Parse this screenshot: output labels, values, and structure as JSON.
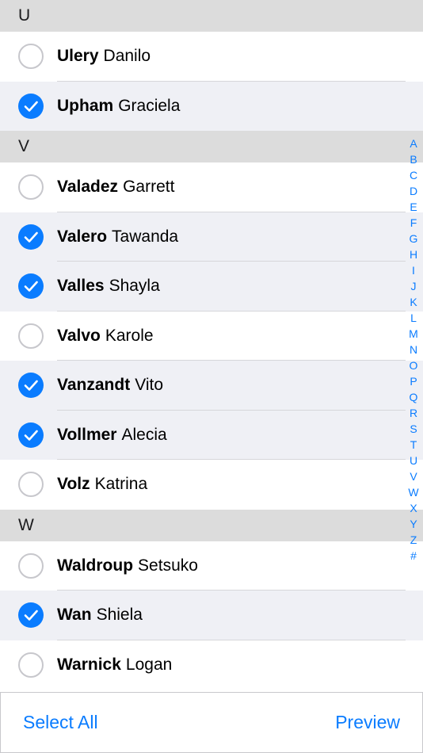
{
  "sections": [
    {
      "header": "U",
      "rows": [
        {
          "last": "Ulery",
          "first": "Danilo",
          "selected": false
        },
        {
          "last": "Upham",
          "first": "Graciela",
          "selected": true
        }
      ]
    },
    {
      "header": "V",
      "rows": [
        {
          "last": "Valadez",
          "first": "Garrett",
          "selected": false
        },
        {
          "last": "Valero",
          "first": "Tawanda",
          "selected": true
        },
        {
          "last": "Valles",
          "first": "Shayla",
          "selected": true
        },
        {
          "last": "Valvo",
          "first": "Karole",
          "selected": false
        },
        {
          "last": "Vanzandt",
          "first": "Vito",
          "selected": true
        },
        {
          "last": "Vollmer",
          "first": "Alecia",
          "selected": true
        },
        {
          "last": "Volz",
          "first": "Katrina",
          "selected": false
        }
      ]
    },
    {
      "header": "W",
      "rows": [
        {
          "last": "Waldroup",
          "first": "Setsuko",
          "selected": false
        },
        {
          "last": "Wan",
          "first": "Shiela",
          "selected": true
        },
        {
          "last": "Warnick",
          "first": "Logan",
          "selected": false
        }
      ]
    }
  ],
  "index_letters": [
    "A",
    "B",
    "C",
    "D",
    "E",
    "F",
    "G",
    "H",
    "I",
    "J",
    "K",
    "L",
    "M",
    "N",
    "O",
    "P",
    "Q",
    "R",
    "S",
    "T",
    "U",
    "V",
    "W",
    "X",
    "Y",
    "Z",
    "#"
  ],
  "toolbar": {
    "select_all_label": "Select All",
    "preview_label": "Preview"
  },
  "icons": {
    "checked": "checkmark-circle-filled-icon",
    "unchecked": "empty-circle-icon"
  },
  "colors": {
    "accent": "#0a7cff",
    "section_header_bg": "#dcdcdc",
    "selected_row_bg": "#eff0f5"
  }
}
